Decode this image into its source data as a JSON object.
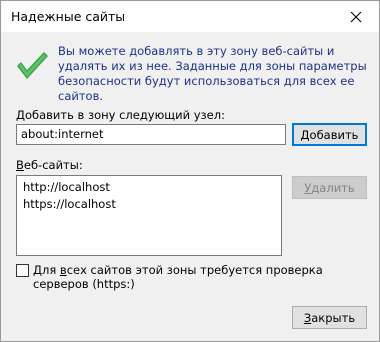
{
  "window": {
    "title": "Надежные сайты"
  },
  "intro_text": "Вы можете добавлять в эту зону  веб-сайты и удалять их из нее. Заданные для зоны параметры безопасности будут использоваться для всех ее сайтов.",
  "add_site": {
    "label_prefix": "",
    "label_underlined": "Д",
    "label_rest": "обавить в зону следующий узел:",
    "value": "about:internet",
    "add_button_underlined": "Д",
    "add_button_rest": "обавить"
  },
  "websites": {
    "label_underlined": "В",
    "label_rest": "еб-сайты:",
    "items": [
      "http://localhost",
      "https://localhost"
    ],
    "remove_button_underlined": "У",
    "remove_button_rest": "далить"
  },
  "https_option": {
    "label_prefix": "Для ",
    "label_underlined": "в",
    "label_rest": "сех сайтов этой зоны требуется проверка серверов (https:)",
    "checked": false
  },
  "close_button": {
    "label_underlined": "З",
    "label_rest": "акрыть"
  },
  "colors": {
    "accent": "#0078d7",
    "intro_text": "#1e3287",
    "check": "#3aa54a"
  },
  "icons": {
    "title_close": "close-icon",
    "zone": "checkmark-icon"
  }
}
